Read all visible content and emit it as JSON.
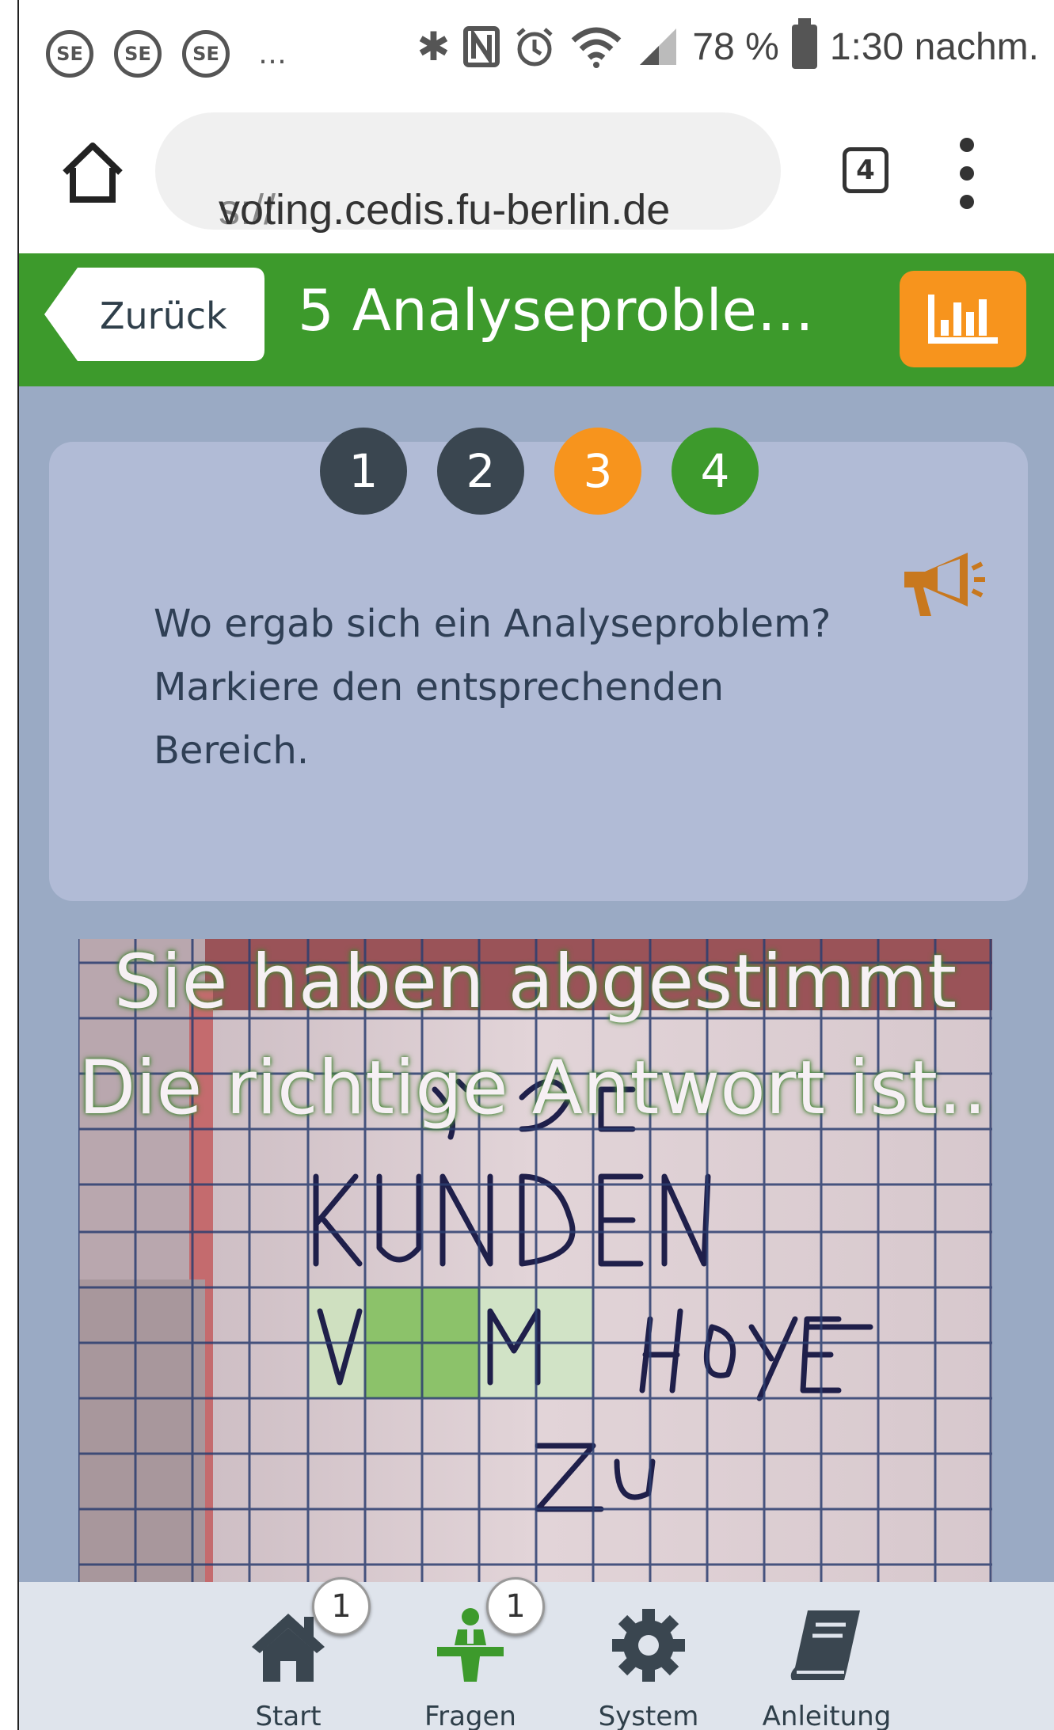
{
  "status_bar": {
    "battery_percent": "78 %",
    "time": "1:30 nachm.",
    "left_icons": [
      "SE",
      "SE",
      "SE"
    ],
    "overflow": "…"
  },
  "browser": {
    "url_prefix": "s://",
    "url_host": "voting.cedis.fu-berlin.de",
    "tab_count": "4"
  },
  "header": {
    "back_label": "Zurück",
    "title": "5 Analyseproble…"
  },
  "steps": [
    {
      "label": "1",
      "state": "done"
    },
    {
      "label": "2",
      "state": "done"
    },
    {
      "label": "3",
      "state": "current"
    },
    {
      "label": "4",
      "state": "next"
    }
  ],
  "question": {
    "line1": "Wo ergab sich ein Analyseproblem?",
    "line2": "Markiere den entsprechenden",
    "line3": "Bereich."
  },
  "image_overlay": {
    "line1": "Sie haben abgestimmt",
    "line2": "Die richtige Antwort ist…"
  },
  "bottom_nav": {
    "start": {
      "label": "Start",
      "badge": "1"
    },
    "fragen": {
      "label": "Fragen",
      "badge": "1"
    },
    "system": {
      "label": "System"
    },
    "anleitung": {
      "label": "Anleitung"
    }
  },
  "colors": {
    "header_green": "#3d9a2c",
    "accent_orange": "#f7941d",
    "content_bg": "#9aaac4",
    "card_bg": "#b1bbd6"
  }
}
